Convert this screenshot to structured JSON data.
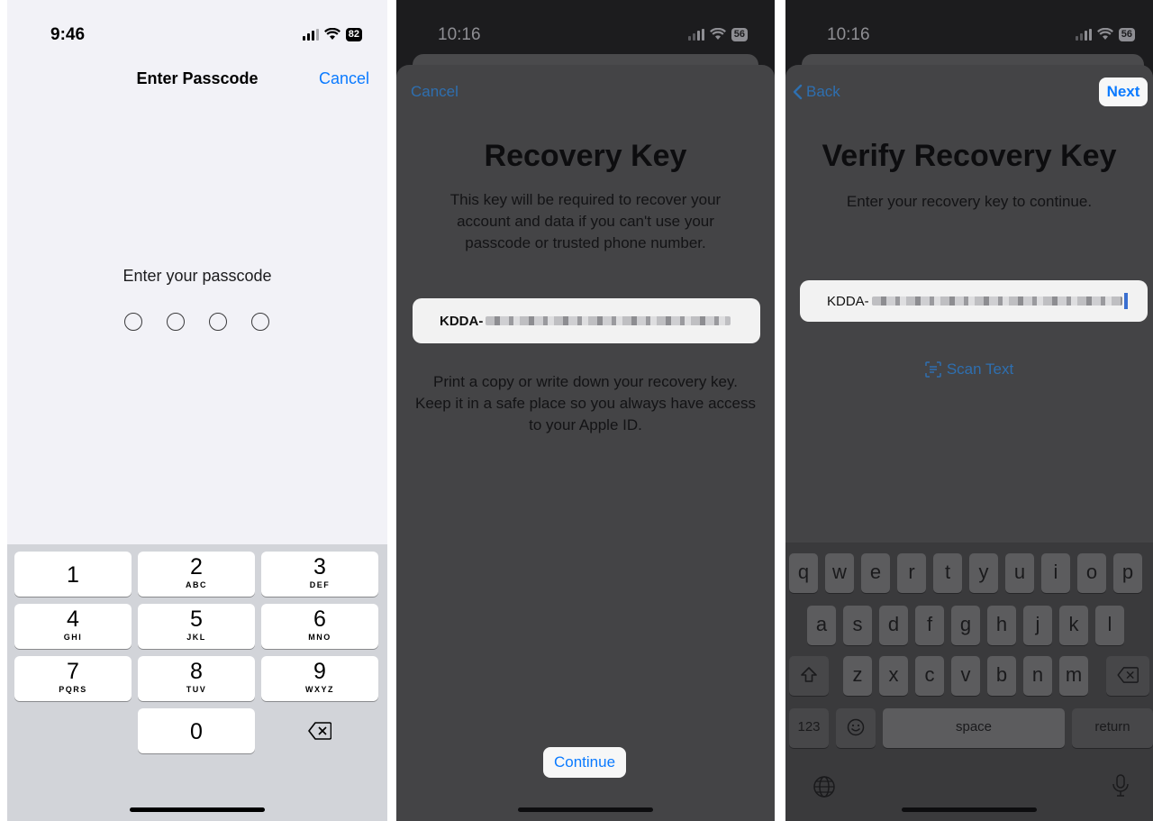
{
  "passcode_screen": {
    "status_time": "9:46",
    "battery": "82",
    "title": "Enter Passcode",
    "cancel_label": "Cancel",
    "prompt": "Enter your passcode",
    "keypad": [
      {
        "num": "1",
        "letters": ""
      },
      {
        "num": "2",
        "letters": "ABC"
      },
      {
        "num": "3",
        "letters": "DEF"
      },
      {
        "num": "4",
        "letters": "GHI"
      },
      {
        "num": "5",
        "letters": "JKL"
      },
      {
        "num": "6",
        "letters": "MNO"
      },
      {
        "num": "7",
        "letters": "PQRS"
      },
      {
        "num": "8",
        "letters": "TUV"
      },
      {
        "num": "9",
        "letters": "WXYZ"
      },
      {
        "num": "0",
        "letters": ""
      }
    ]
  },
  "recovery_key_screen": {
    "status_time": "10:16",
    "battery": "56",
    "cancel_label": "Cancel",
    "title": "Recovery Key",
    "description": "This key will be required to recover your account and data if you can't use your passcode or trusted phone number.",
    "key_prefix": "KDDA-",
    "instructions": "Print a copy or write down your recovery key. Keep it in a safe place so you always have access to your Apple ID.",
    "continue_label": "Continue"
  },
  "verify_screen": {
    "status_time": "10:16",
    "battery": "56",
    "back_label": "Back",
    "next_label": "Next",
    "title": "Verify Recovery Key",
    "subtitle": "Enter your recovery key to continue.",
    "key_prefix": "KDDA-",
    "scan_label": "Scan Text",
    "keyboard": {
      "row1": [
        "q",
        "w",
        "e",
        "r",
        "t",
        "y",
        "u",
        "i",
        "o",
        "p"
      ],
      "row2": [
        "a",
        "s",
        "d",
        "f",
        "g",
        "h",
        "j",
        "k",
        "l"
      ],
      "row3": [
        "z",
        "x",
        "c",
        "v",
        "b",
        "n",
        "m"
      ],
      "numbers_label": "123",
      "space_label": "space",
      "return_label": "return"
    }
  },
  "icons": [
    "signal-icon",
    "wifi-icon",
    "battery-icon",
    "delete-icon",
    "back-chevron-icon",
    "scan-text-icon",
    "shift-icon",
    "emoji-icon",
    "globe-icon",
    "microphone-icon"
  ]
}
